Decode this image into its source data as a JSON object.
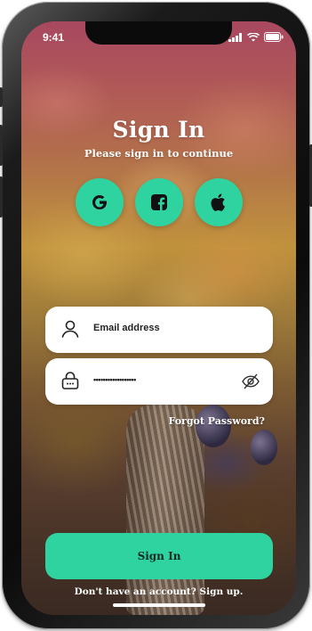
{
  "status_bar": {
    "time": "9:41",
    "icons": [
      "signal-icon",
      "wifi-icon",
      "battery-icon"
    ]
  },
  "screen": {
    "title": "Sign In",
    "subtitle": "Please sign in to continue"
  },
  "social_buttons": [
    {
      "name": "google",
      "icon": "google-icon"
    },
    {
      "name": "facebook",
      "icon": "facebook-icon"
    },
    {
      "name": "apple",
      "icon": "apple-icon"
    }
  ],
  "email_field": {
    "placeholder": "Email address",
    "icon": "user-icon"
  },
  "password_field": {
    "value": "••••••••••••••••••",
    "icon": "lock-icon",
    "toggle_icon": "eye-off-icon"
  },
  "forgot_password": "Forgot Password?",
  "sign_in_button": "Sign In",
  "sign_up_prompt": "Don't have an account? Sign up.",
  "colors": {
    "accent": "#2fd3a0",
    "field_background": "#ffffff",
    "text_on_photo": "#ffffff"
  }
}
